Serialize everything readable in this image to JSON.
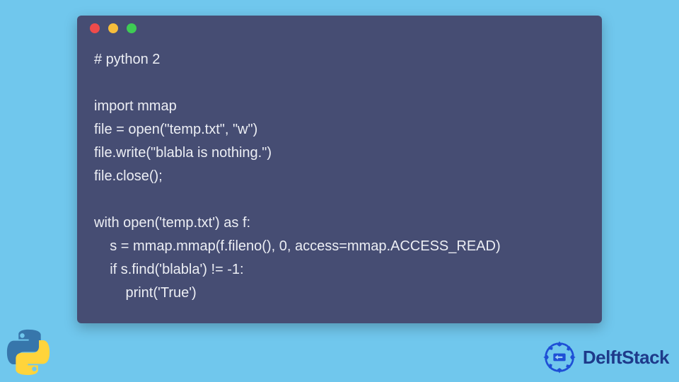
{
  "code": {
    "lines": [
      "# python 2",
      "",
      "import mmap",
      "file = open(\"temp.txt\", \"w\")",
      "file.write(\"blabla is nothing.\")",
      "file.close();",
      "",
      "with open('temp.txt') as f:",
      "    s = mmap.mmap(f.fileno(), 0, access=mmap.ACCESS_READ)",
      "    if s.find('blabla') != -1:",
      "        print('True')"
    ]
  },
  "branding": {
    "name": "DelftStack"
  },
  "colors": {
    "page_bg": "#70c7ed",
    "window_bg": "#464d73",
    "dot_red": "#ef4b4b",
    "dot_yellow": "#f6bd3b",
    "dot_green": "#3ecc54",
    "code_text": "#eceef4",
    "brand_text": "#1e3a8a"
  }
}
